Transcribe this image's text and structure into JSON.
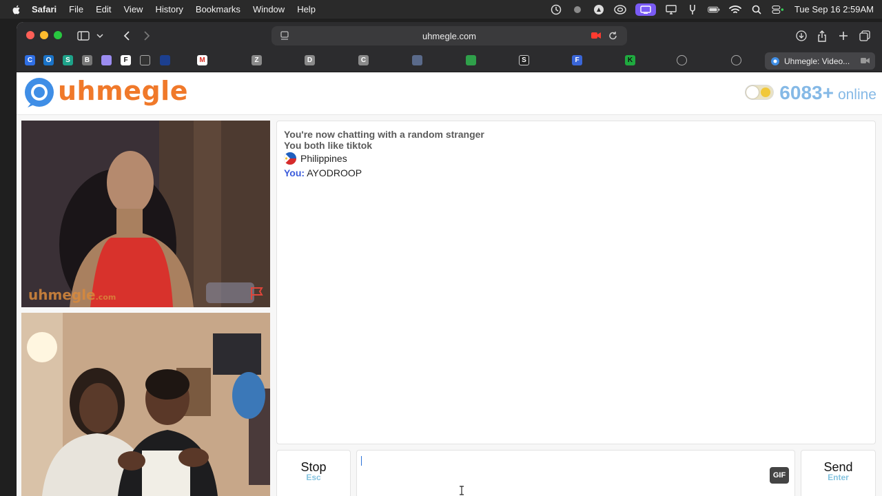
{
  "menubar": {
    "app_name": "Safari",
    "items": [
      "File",
      "Edit",
      "View",
      "History",
      "Bookmarks",
      "Window",
      "Help"
    ],
    "datetime": "Tue Sep 16  2:59AM"
  },
  "browser": {
    "address": "uhmegle.com",
    "favorites": [
      "C",
      "O",
      "S",
      "B",
      "",
      "F",
      "",
      "",
      "M",
      "Z",
      "D",
      "C",
      "",
      "",
      "S",
      "F",
      "K",
      "",
      ""
    ],
    "active_tab_title": "Uhmegle: Video..."
  },
  "site": {
    "logo_text": "uhmegle",
    "online_count": "6083+",
    "online_label": "online",
    "watermark_main": "uhmegle",
    "watermark_suffix": ".com"
  },
  "chat": {
    "status_1": "You're now chatting with a random stranger",
    "status_2": "You both like tiktok",
    "country": "Philippines",
    "you_label": "You:",
    "you_message": "AYODROOP"
  },
  "controls": {
    "stop_label": "Stop",
    "stop_hint": "Esc",
    "send_label": "Send",
    "send_hint": "Enter",
    "gif_label": "GIF",
    "message_value": ""
  },
  "colors": {
    "logo_orange": "#f0792a",
    "online_blue": "#85b9e6",
    "you_blue": "#3b5bdb",
    "hint_blue": "#85c3df"
  }
}
